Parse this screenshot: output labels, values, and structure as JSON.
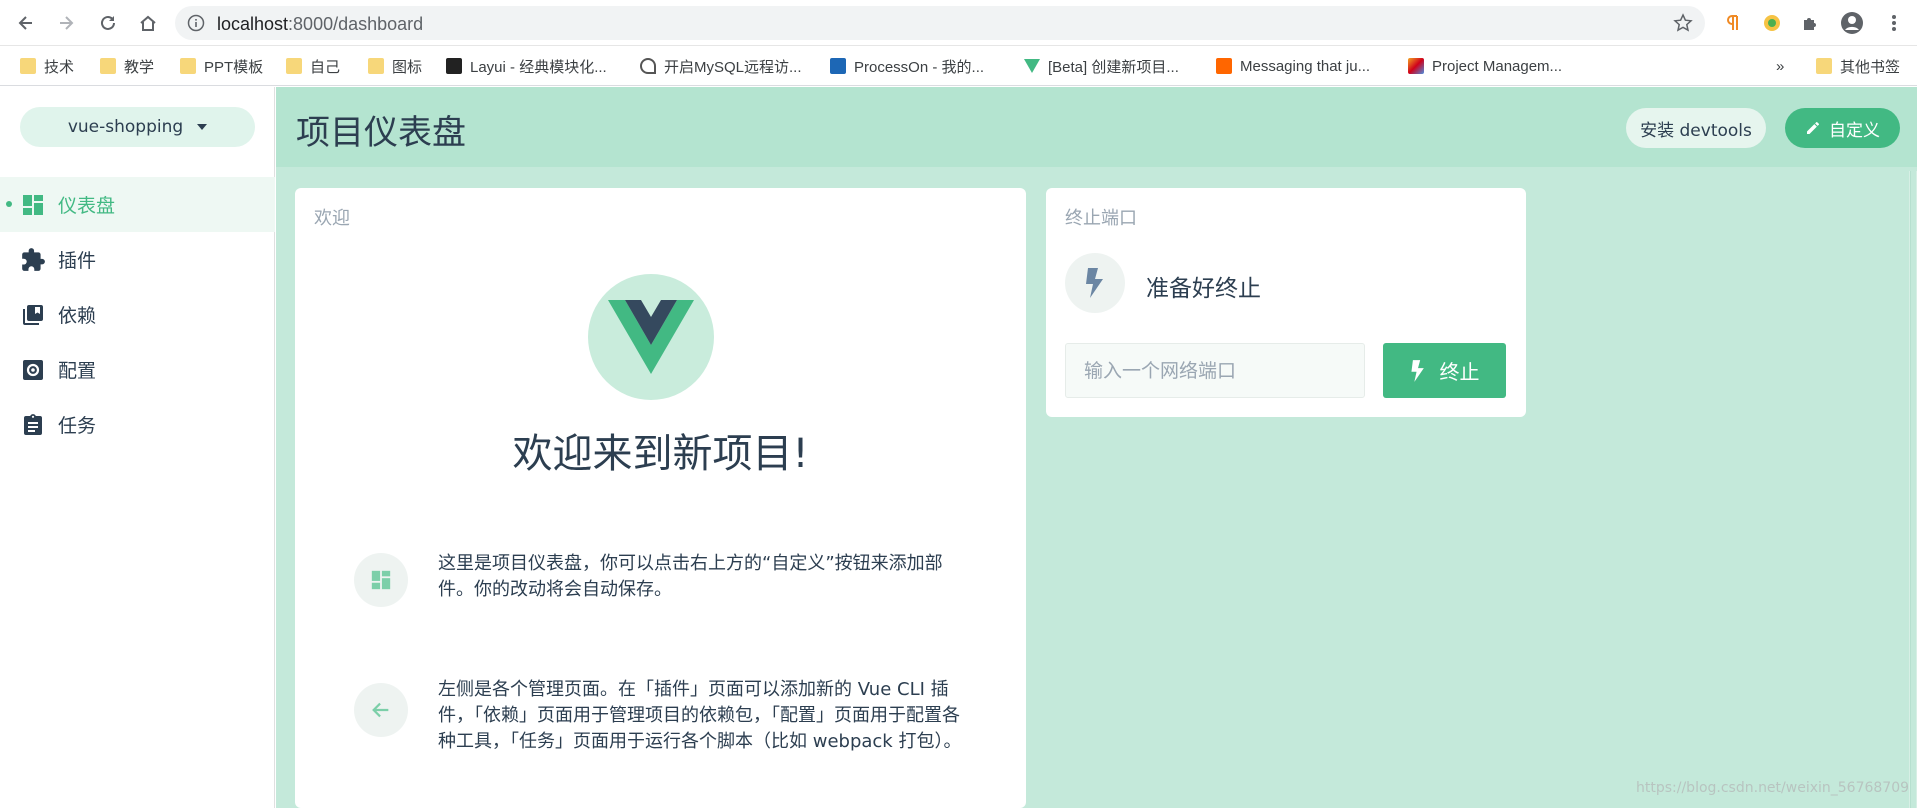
{
  "browser": {
    "url_host": "localhost",
    "url_path": ":8000/dashboard",
    "bookmarks": [
      "技术",
      "教学",
      "PPT模板",
      "自己",
      "图标",
      "Layui - 经典模块化...",
      "开启MySQL远程访...",
      "ProcessOn - 我的...",
      "[Beta] 创建新项目...",
      "Messaging that ju...",
      "Project Managem..."
    ],
    "more": "»",
    "other_bookmarks": "其他书签"
  },
  "sidebar": {
    "project": "vue-shopping",
    "items": [
      {
        "label": "仪表盘",
        "icon": "dashboard-icon",
        "active": true
      },
      {
        "label": "插件",
        "icon": "puzzle-icon",
        "active": false
      },
      {
        "label": "依赖",
        "icon": "library-books-icon",
        "active": false
      },
      {
        "label": "配置",
        "icon": "settings-icon",
        "active": false
      },
      {
        "label": "任务",
        "icon": "clipboard-icon",
        "active": false
      }
    ]
  },
  "header": {
    "title": "项目仪表盘",
    "devtools_label": "安装 devtools",
    "customize_label": "自定义"
  },
  "welcome": {
    "title": "欢迎",
    "heading": "欢迎来到新项目!",
    "tip1": "这里是项目仪表盘，你可以点击右上方的“自定义”按钮来添加部件。你的改动将会自动保存。",
    "tip2": "左侧是各个管理页面。在「插件」页面可以添加新的 Vue CLI 插件，「依赖」页面用于管理项目的依赖包，「配置」页面用于配置各种工具，「任务」页面用于运行各个脚本（比如 webpack 打包）。"
  },
  "kill_port": {
    "title": "终止端口",
    "status": "准备好终止",
    "placeholder": "输入一个网络端口",
    "button_label": "终止"
  },
  "watermark": "https://blog.csdn.net/weixin_56768709",
  "colors": {
    "accent": "#42b983",
    "main_bg": "#c4e9da",
    "header_bg": "#b4e4d0"
  }
}
